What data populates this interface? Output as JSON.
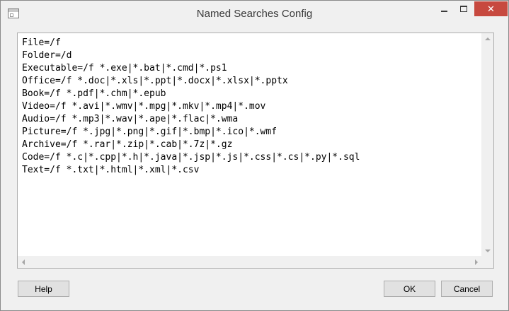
{
  "window": {
    "title": "Named Searches Config",
    "close_glyph": "✕",
    "icons": {
      "app": "window-app-icon",
      "minimize": "minimize-icon",
      "maximize": "maximize-icon",
      "close": "close-icon"
    },
    "colors": {
      "close_button": "#c7493f",
      "background": "#f0f0f0"
    }
  },
  "editor": {
    "lines": [
      "File=/f",
      "Folder=/d",
      "Executable=/f *.exe|*.bat|*.cmd|*.ps1",
      "Office=/f *.doc|*.xls|*.ppt|*.docx|*.xlsx|*.pptx",
      "Book=/f *.pdf|*.chm|*.epub",
      "Video=/f *.avi|*.wmv|*.mpg|*.mkv|*.mp4|*.mov",
      "Audio=/f *.mp3|*.wav|*.ape|*.flac|*.wma",
      "Picture=/f *.jpg|*.png|*.gif|*.bmp|*.ico|*.wmf",
      "Archive=/f *.rar|*.zip|*.cab|*.7z|*.gz",
      "Code=/f *.c|*.cpp|*.h|*.java|*.jsp|*.js|*.css|*.cs|*.py|*.sql",
      "Text=/f *.txt|*.html|*.xml|*.csv"
    ]
  },
  "buttons": {
    "help": "Help",
    "ok": "OK",
    "cancel": "Cancel"
  }
}
